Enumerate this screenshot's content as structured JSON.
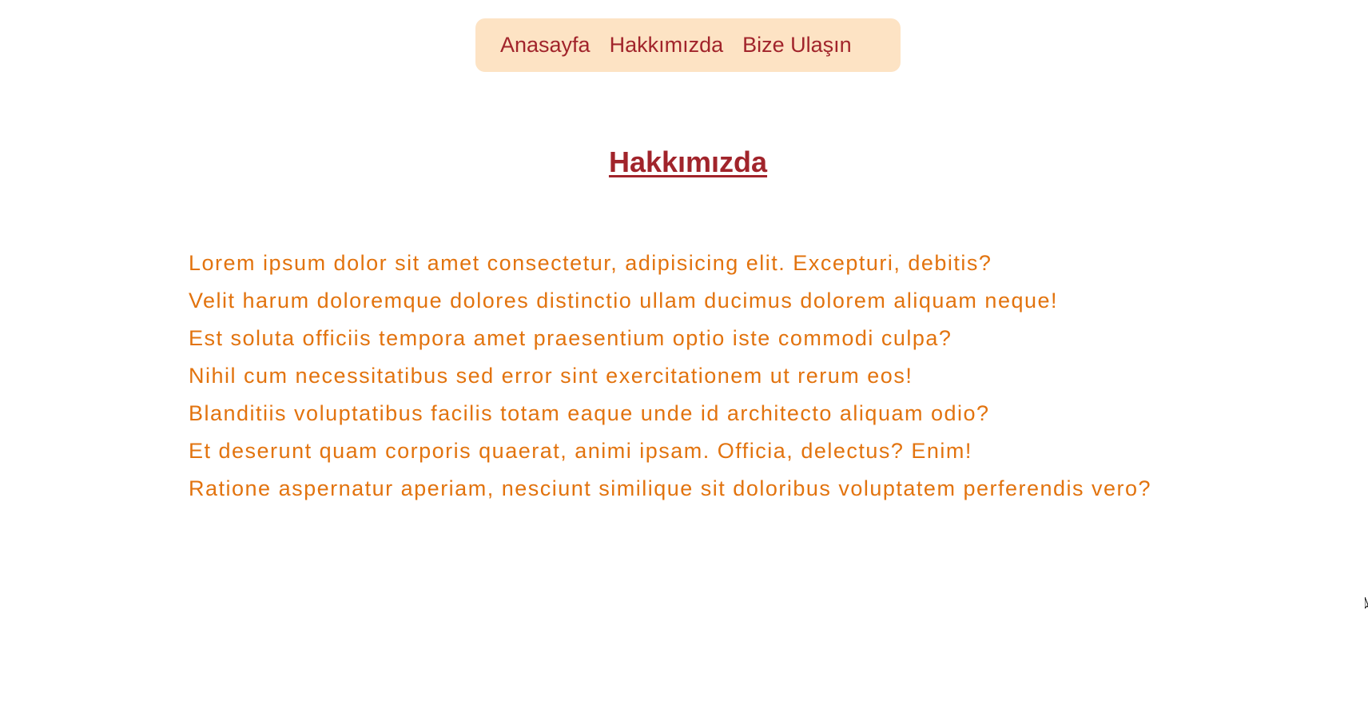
{
  "nav": {
    "items": [
      {
        "label": "Anasayfa"
      },
      {
        "label": "Hakkımızda"
      },
      {
        "label": "Bize Ulaşın"
      }
    ]
  },
  "page": {
    "title": "Hakkımızda",
    "lines": [
      "Lorem ipsum dolor sit amet consectetur, adipisicing elit. Excepturi, debitis?",
      "Velit harum doloremque dolores distinctio ullam ducimus dolorem aliquam neque!",
      "Est soluta officiis tempora amet praesentium optio iste commodi culpa?",
      "Nihil cum necessitatibus sed error sint exercitationem ut rerum eos!",
      "Blanditiis voluptatibus facilis totam eaque unde id architecto aliquam odio?",
      "Et deserunt quam corporis quaerat, animi ipsam. Officia, delectus? Enim!",
      "Ratione aspernatur aperiam, nesciunt similique sit doloribus voluptatem perferendis vero?"
    ]
  },
  "colors": {
    "nav_background": "#fde3c4",
    "link": "#a1242b",
    "body_text": "#e2730e"
  }
}
